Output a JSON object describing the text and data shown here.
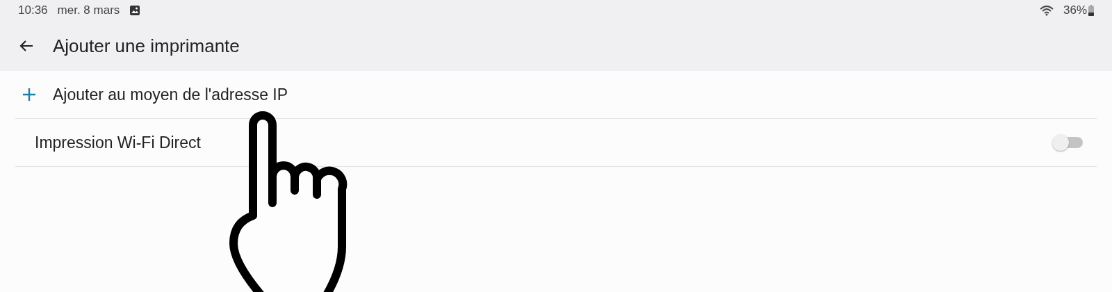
{
  "status_bar": {
    "time": "10:36",
    "date": "mer. 8 mars",
    "battery": "36%"
  },
  "header": {
    "title": "Ajouter une imprimante"
  },
  "items": [
    {
      "kind": "action",
      "label": "Ajouter au moyen de l'adresse IP"
    },
    {
      "kind": "toggle",
      "label": "Impression Wi-Fi Direct",
      "on": false
    }
  ]
}
